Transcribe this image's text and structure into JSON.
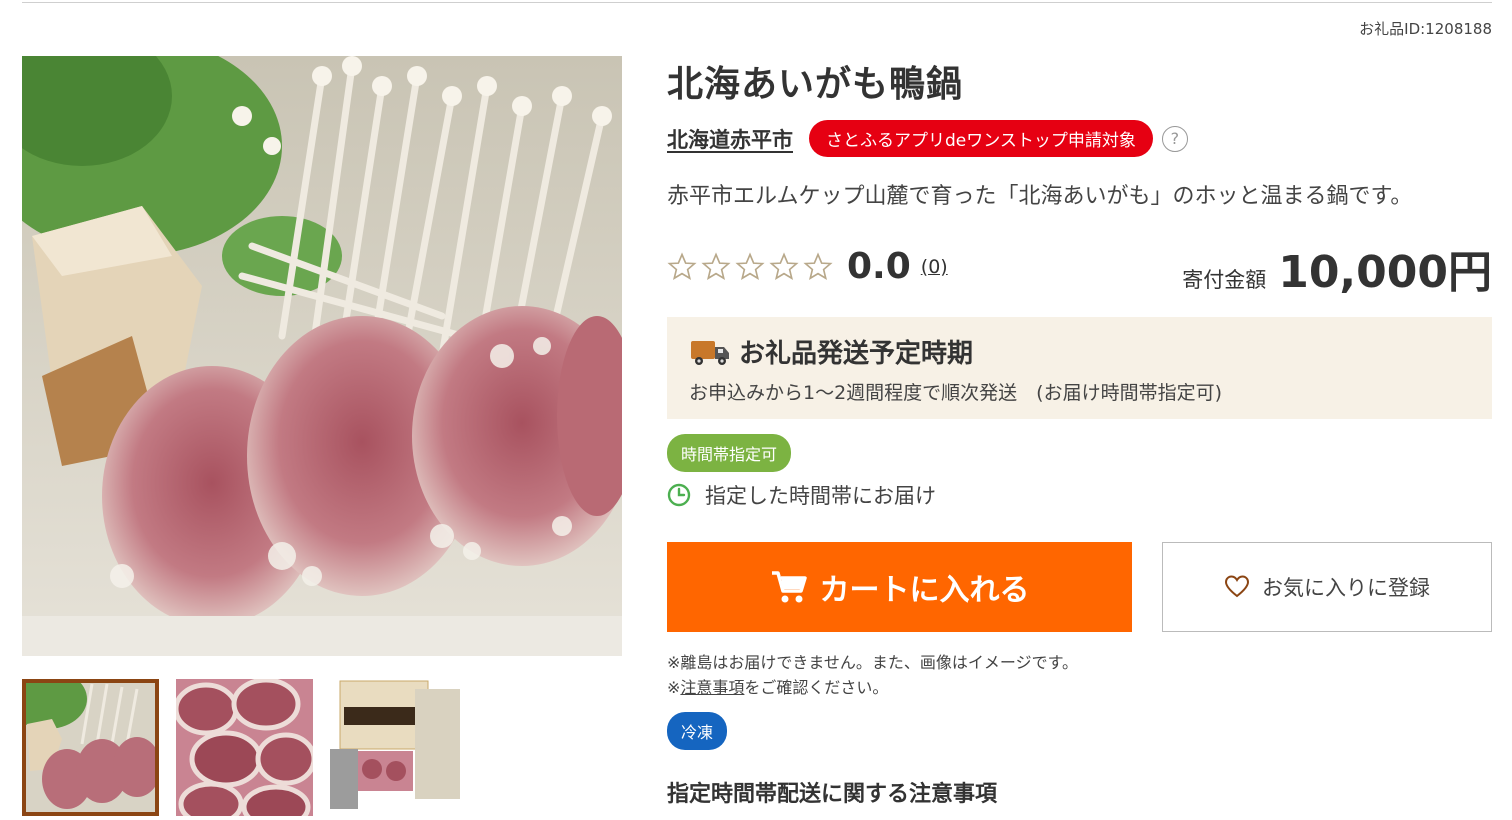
{
  "product": {
    "id_label": "お礼品ID:1208188",
    "title": "北海あいがも鴨鍋",
    "city": "北海道赤平市",
    "app_badge": "さとふるアプリdeワンストップ申請対象",
    "help": "?",
    "description": "赤平市エルムケップ山麓で育った「北海あいがも」のホッと温まる鍋です。"
  },
  "rating": {
    "stars_filled": 0,
    "stars_total": 5,
    "value": "0.0",
    "count": "(0)"
  },
  "price": {
    "label": "寄付金額",
    "value": "10,000円"
  },
  "shipping": {
    "title": "お礼品発送予定時期",
    "text": "お申込みから1〜2週間程度で順次発送　(お届け時間帯指定可)"
  },
  "time_delivery": {
    "badge": "時間帯指定可",
    "text": "指定した時間帯にお届け"
  },
  "actions": {
    "cart": "カートに入れる",
    "favorite": "お気に入りに登録"
  },
  "notes": {
    "line1": "※離島はお届けできません。また、画像はイメージです。",
    "line2_prefix": "※",
    "line2_link": "注意事項",
    "line2_suffix": "をご確認ください。"
  },
  "storage_badge": "冷凍",
  "section_heading": "指定時間帯配送に関する注意事項",
  "colors": {
    "accent_orange": "#ff6600",
    "app_badge_red": "#e60012",
    "time_badge_green": "#7cb342",
    "frozen_badge_blue": "#1565c0",
    "thumb_active_border": "#8b4513",
    "ship_box_bg": "#f7f1e6"
  },
  "icons": {
    "cart": "cart-icon",
    "heart": "heart-icon",
    "truck": "truck-icon",
    "clock": "clock-icon",
    "star": "star-outline-icon"
  }
}
